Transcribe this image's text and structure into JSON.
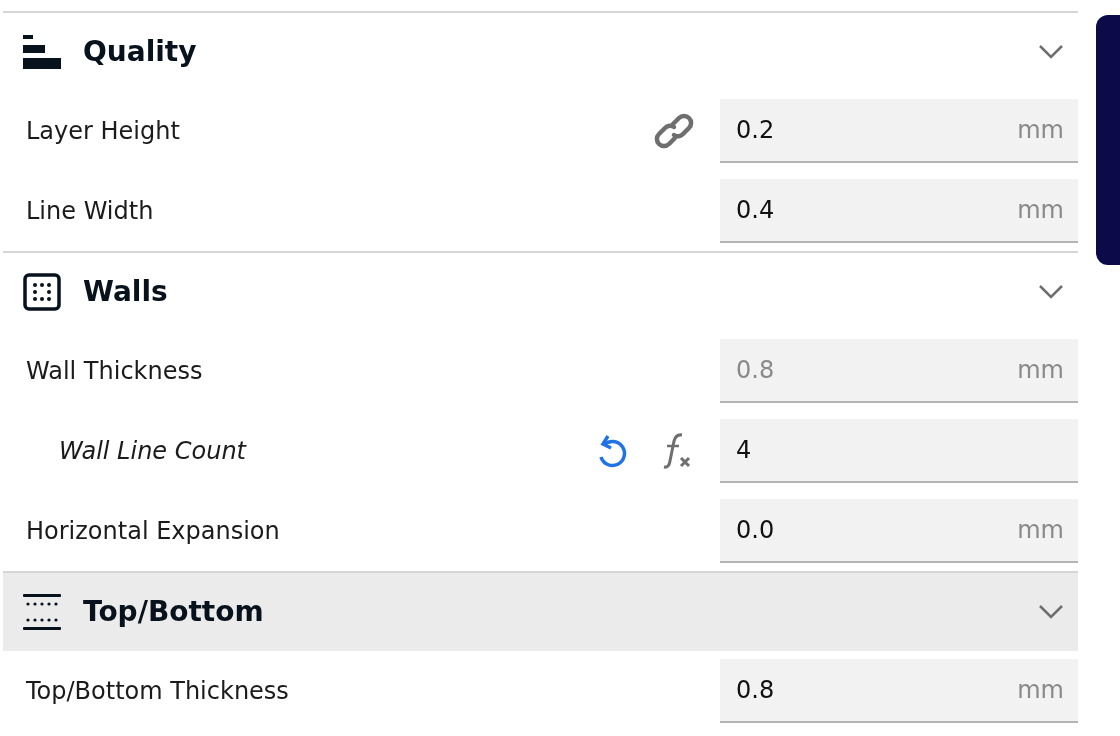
{
  "sections": [
    {
      "kind": "quality",
      "title": "Quality",
      "highlighted": false,
      "settings": [
        {
          "label": "Layer Height",
          "value": "0.2",
          "unit": "mm",
          "italic": false,
          "disabled": false,
          "linked": true,
          "resettable": false,
          "formula": false
        },
        {
          "label": "Line Width",
          "value": "0.4",
          "unit": "mm",
          "italic": false,
          "disabled": false,
          "linked": false,
          "resettable": false,
          "formula": false
        }
      ]
    },
    {
      "kind": "walls",
      "title": "Walls",
      "highlighted": false,
      "settings": [
        {
          "label": "Wall Thickness",
          "value": "0.8",
          "unit": "mm",
          "italic": false,
          "disabled": true,
          "linked": false,
          "resettable": false,
          "formula": false
        },
        {
          "label": "Wall Line Count",
          "value": "4",
          "italic": true,
          "disabled": false,
          "linked": false,
          "resettable": true,
          "formula": true
        },
        {
          "label": "Horizontal Expansion",
          "value": "0.0",
          "unit": "mm",
          "italic": false,
          "disabled": false,
          "linked": false,
          "resettable": false,
          "formula": false
        }
      ]
    },
    {
      "kind": "topbottom",
      "title": "Top/Bottom",
      "highlighted": true,
      "settings": [
        {
          "label": "Top/Bottom Thickness",
          "value": "0.8",
          "unit": "mm",
          "italic": false,
          "disabled": false,
          "linked": false,
          "resettable": false,
          "formula": false
        }
      ]
    }
  ]
}
